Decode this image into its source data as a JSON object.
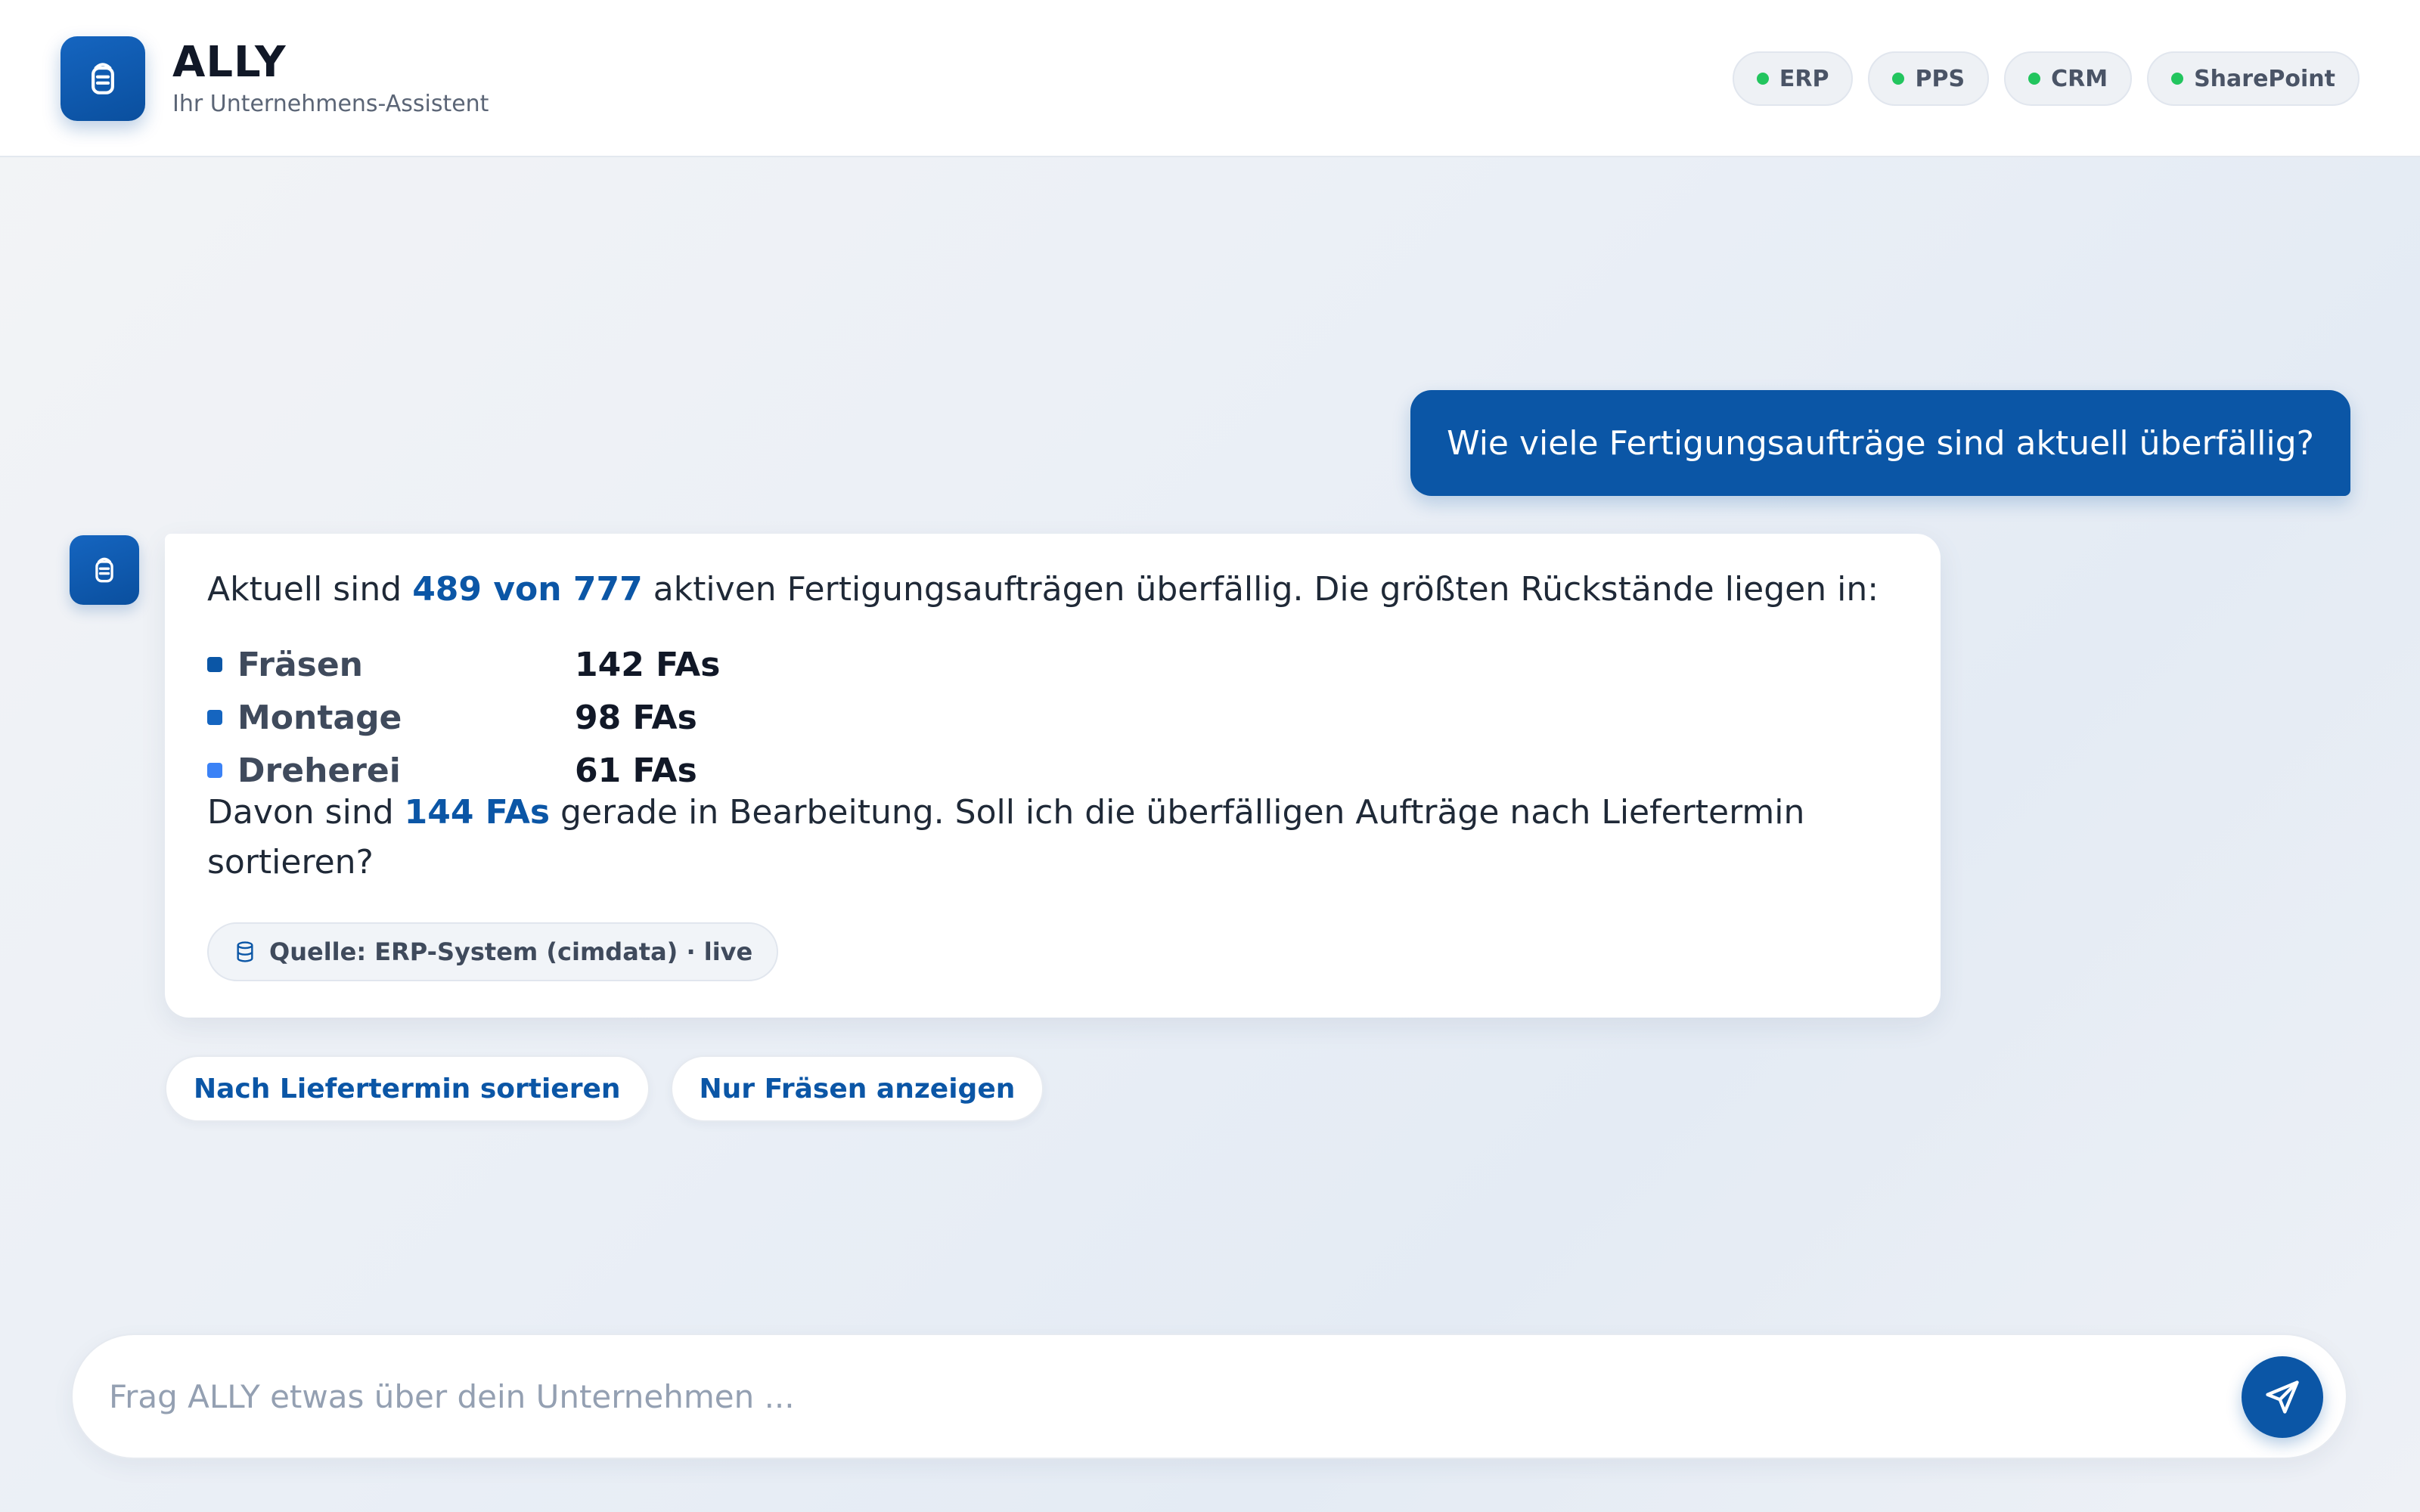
{
  "header": {
    "brand_title": "ALLY",
    "brand_subtitle": "Ihr Unternehmens-Assistent",
    "systems": [
      {
        "label": "ERP",
        "status_color": "#22c55e"
      },
      {
        "label": "PPS",
        "status_color": "#22c55e"
      },
      {
        "label": "CRM",
        "status_color": "#22c55e"
      },
      {
        "label": "SharePoint",
        "status_color": "#22c55e"
      }
    ]
  },
  "chat": {
    "user_message": "Wie viele Fertigungsaufträge sind aktuell überfällig?",
    "assistant": {
      "intro_before": "Aktuell sind ",
      "intro_highlight": "489 von 777",
      "intro_after": " aktiven Fertigungsaufträgen überfällig. Die größten Rückstände liegen in:",
      "backlog": [
        {
          "label": "Fräsen",
          "value": "142 FAs",
          "color": "#0b56a6"
        },
        {
          "label": "Montage",
          "value": "98 FAs",
          "color": "#1565c0"
        },
        {
          "label": "Dreherei",
          "value": "61 FAs",
          "color": "#3b82f6"
        }
      ],
      "followup_before": "Davon sind ",
      "followup_highlight": "144 FAs",
      "followup_after": " gerade in Bearbeitung. Soll ich die überfälligen Aufträge nach Liefertermin sortieren?",
      "source": "Quelle: ERP-System (cimdata) · live"
    },
    "suggestions": [
      "Nach Liefertermin sortieren",
      "Nur Fräsen anzeigen"
    ]
  },
  "input": {
    "placeholder": "Frag ALLY etwas über dein Unternehmen ...",
    "value": ""
  },
  "icons": {
    "logo": "ally-logo-icon",
    "source": "database-icon",
    "send": "send-icon"
  },
  "colors": {
    "accent": "#0b56a6",
    "status_online": "#22c55e"
  }
}
